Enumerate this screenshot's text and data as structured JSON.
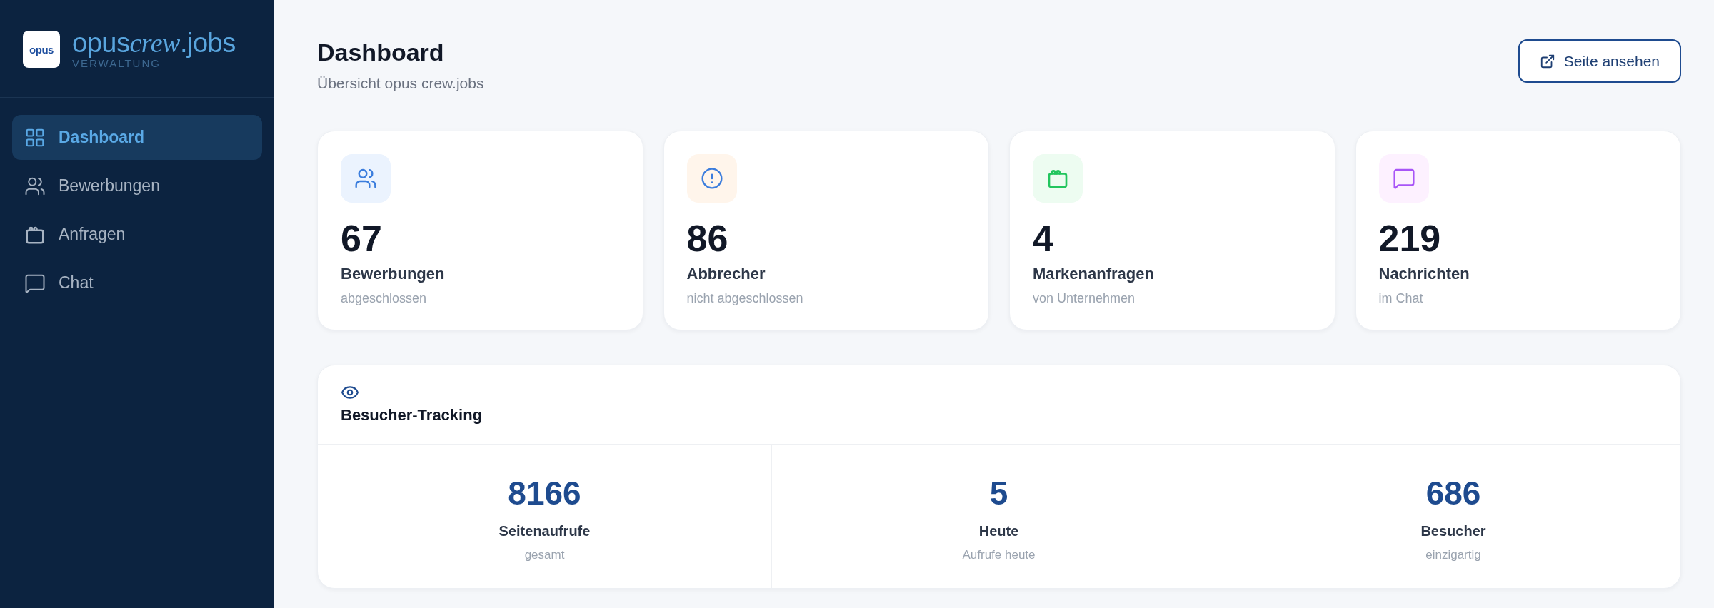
{
  "sidebar": {
    "logo": {
      "mark": "opus",
      "title": [
        {
          "text": "opus",
          "italic": false
        },
        {
          "text": "crew",
          "italic": true
        },
        {
          "text": ".jobs",
          "italic": false
        }
      ],
      "subtitle": "VERWALTUNG"
    },
    "items": [
      {
        "label": "Dashboard",
        "selected": true
      },
      {
        "label": "Bewerbungen",
        "selected": false
      },
      {
        "label": "Anfragen",
        "selected": false
      },
      {
        "label": "Chat",
        "selected": false
      }
    ]
  },
  "header": {
    "title": "Dashboard",
    "subtitle": "Übersicht opus crew.jobs",
    "button": "Seite ansehen"
  },
  "stats": [
    {
      "value": "67",
      "label": "Bewerbungen",
      "note": "abgeschlossen"
    },
    {
      "value": "86",
      "label": "Abbrecher",
      "note": "nicht abgeschlossen"
    },
    {
      "value": "4",
      "label": "Markenanfragen",
      "note": "von Unternehmen"
    },
    {
      "value": "219",
      "label": "Nachrichten",
      "note": "im Chat"
    }
  ],
  "tracking": {
    "title": "Besucher-Tracking",
    "metrics": [
      {
        "value": "8166",
        "label": "Seitenaufrufe",
        "note": "gesamt"
      },
      {
        "value": "5",
        "label": "Heute",
        "note": "Aufrufe heute"
      },
      {
        "value": "686",
        "label": "Besucher",
        "note": "einzigartig"
      }
    ]
  }
}
